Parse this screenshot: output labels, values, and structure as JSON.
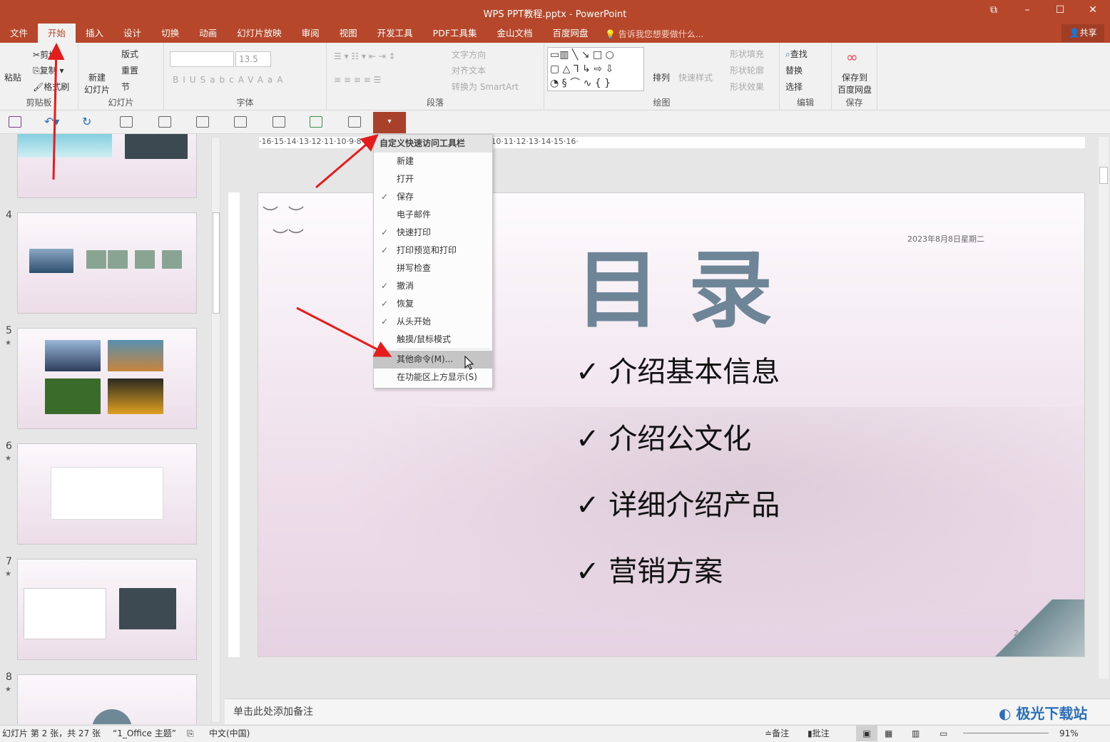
{
  "window": {
    "title": "WPS PPT教程.pptx - PowerPoint",
    "controls": [
      "⧉",
      "–",
      "☐",
      "✕"
    ]
  },
  "tabs": [
    "文件",
    "开始",
    "插入",
    "设计",
    "切换",
    "动画",
    "幻灯片放映",
    "审阅",
    "视图",
    "开发工具",
    "PDF工具集",
    "金山文档",
    "百度网盘"
  ],
  "active_tab": "开始",
  "tell_me": "告诉我您想要做什么...",
  "share": "共享",
  "ribbon": {
    "clipboard": {
      "label": "剪贴板",
      "paste": "粘贴",
      "cut": "剪切",
      "copy": "复制",
      "format_painter": "格式刷"
    },
    "slides": {
      "label": "幻灯片",
      "new_slide": "新建\n幻灯片",
      "layout": "版式",
      "reset": "重置",
      "section": "节"
    },
    "font": {
      "label": "字体",
      "font_name": "",
      "font_size": "13.5",
      "buttons": [
        "B",
        "I",
        "U",
        "S",
        "abc",
        "AV",
        "Aa",
        "A"
      ]
    },
    "paragraph": {
      "label": "段落",
      "text_direction": "文字方向",
      "align_text": "对齐文本",
      "smartart": "转换为 SmartArt"
    },
    "drawing": {
      "label": "绘图",
      "arrange": "排列",
      "quick_styles": "快速样式",
      "shape_fill": "形状填充",
      "shape_outline": "形状轮廓",
      "shape_effects": "形状效果"
    },
    "editing": {
      "label": "编辑",
      "find": "查找",
      "replace": "替换",
      "select": "选择"
    },
    "save": {
      "label": "保存",
      "save_to": "保存到\n百度网盘"
    }
  },
  "qat_menu": {
    "header": "自定义快速访问工具栏",
    "items": [
      {
        "label": "新建",
        "checked": false
      },
      {
        "label": "打开",
        "checked": false
      },
      {
        "label": "保存",
        "checked": true
      },
      {
        "label": "电子邮件",
        "checked": false
      },
      {
        "label": "快速打印",
        "checked": true
      },
      {
        "label": "打印预览和打印",
        "checked": true
      },
      {
        "label": "拼写检查",
        "checked": false
      },
      {
        "label": "撤消",
        "checked": true
      },
      {
        "label": "恢复",
        "checked": true
      },
      {
        "label": "从头开始",
        "checked": true
      },
      {
        "label": "触摸/鼠标模式",
        "checked": false
      }
    ],
    "more": "其他命令(M)...",
    "show_above": "在功能区上方显示(S)"
  },
  "ruler": "·16·15·14·13·12·11·10·9·8·7·6·5·4·3·2·1·0·1·2·3·4·5·6·7·8·9·10·11·12·13·14·15·16·",
  "thumbnails": [
    {
      "num": "4",
      "star": ""
    },
    {
      "num": "5",
      "star": "★"
    },
    {
      "num": "6",
      "star": "★"
    },
    {
      "num": "7",
      "star": "★"
    },
    {
      "num": "8",
      "star": "★"
    }
  ],
  "slide": {
    "title": "目录",
    "date": "2023年8月8日星期二",
    "bullets": [
      "✓ 介绍基本信息",
      "✓ 介绍公文化",
      "✓ 详细介绍产品",
      "✓ 营销方案"
    ],
    "number": "2"
  },
  "notes_placeholder": "单击此处添加备注",
  "status": {
    "slide_info": "幻灯片 第 2 张，共 27 张",
    "theme": "“1_Office 主题”",
    "language": "中文(中国)",
    "notes": "备注",
    "comments": "批注",
    "zoom": "91%"
  },
  "watermark": "极光下载站",
  "colors": {
    "accent": "#b7472a",
    "slide_title": "#6d8597"
  }
}
